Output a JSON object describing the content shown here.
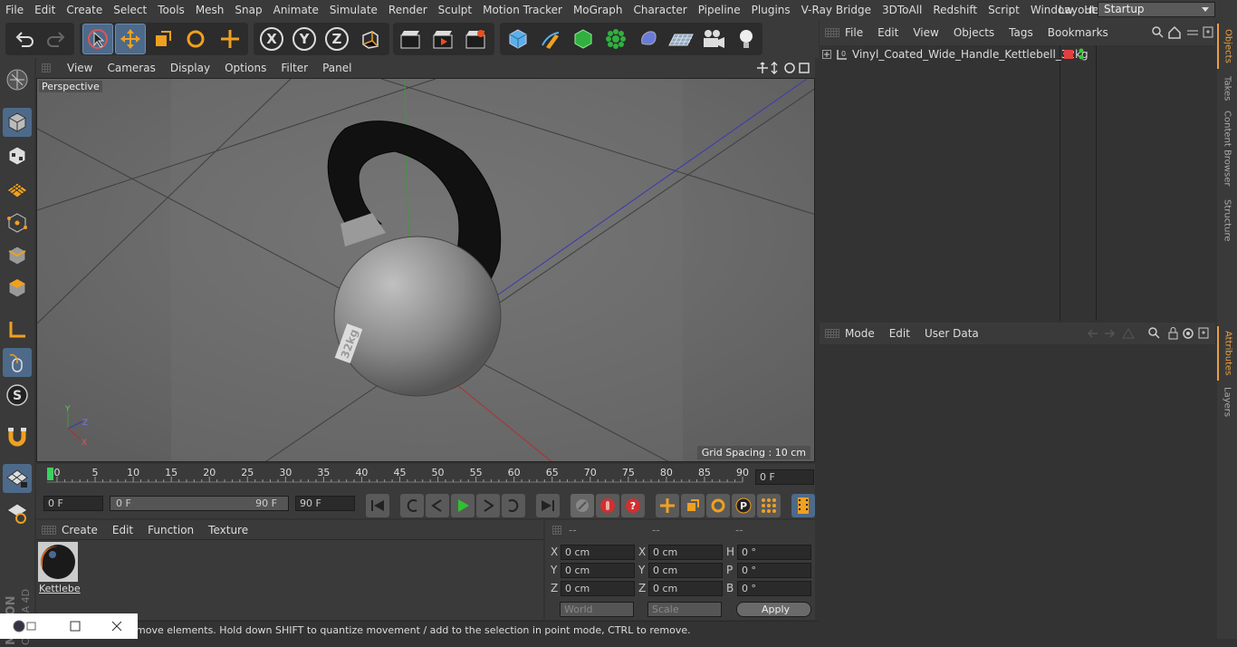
{
  "menubar": {
    "items": [
      "File",
      "Edit",
      "Create",
      "Select",
      "Tools",
      "Mesh",
      "Snap",
      "Animate",
      "Simulate",
      "Render",
      "Sculpt",
      "Motion Tracker",
      "MoGraph",
      "Character",
      "Pipeline",
      "Plugins",
      "V-Ray Bridge",
      "3DToAll",
      "Redshift",
      "Script",
      "Window",
      "Help"
    ],
    "layout_label": "Layout:",
    "layout_value": "Startup"
  },
  "viewport": {
    "menu": [
      "View",
      "Cameras",
      "Display",
      "Options",
      "Filter",
      "Panel"
    ],
    "label": "Perspective",
    "grid_spacing": "Grid Spacing : 10 cm",
    "kettlebell_text": "32kg"
  },
  "timeline": {
    "ticks": [
      "0",
      "5",
      "10",
      "15",
      "20",
      "25",
      "30",
      "35",
      "40",
      "45",
      "50",
      "55",
      "60",
      "65",
      "70",
      "75",
      "80",
      "85",
      "90"
    ],
    "current_frame": "0 F"
  },
  "transport": {
    "start_field": "0 F",
    "range_start": "0 F",
    "range_end": "90 F",
    "end_field": "90 F"
  },
  "material_manager": {
    "menu": [
      "Create",
      "Edit",
      "Function",
      "Texture"
    ],
    "material_name": "Kettlebe"
  },
  "coordinates": {
    "headers": [
      "--",
      "--",
      "--"
    ],
    "rows": [
      {
        "a_label": "X",
        "a_val": "0 cm",
        "b_label": "X",
        "b_val": "0 cm",
        "c_label": "H",
        "c_val": "0 °"
      },
      {
        "a_label": "Y",
        "a_val": "0 cm",
        "b_label": "Y",
        "b_val": "0 cm",
        "c_label": "P",
        "c_val": "0 °"
      },
      {
        "a_label": "Z",
        "a_val": "0 cm",
        "b_label": "Z",
        "b_val": "0 cm",
        "c_label": "B",
        "c_val": "0 °"
      }
    ],
    "mode_world": "World",
    "mode_scale": "Scale",
    "apply": "Apply"
  },
  "object_manager": {
    "menu": [
      "File",
      "Edit",
      "View",
      "Objects",
      "Tags",
      "Bookmarks"
    ],
    "object_name": "Vinyl_Coated_Wide_Handle_Kettlebell_32kg"
  },
  "attribute_manager": {
    "menu": [
      "Mode",
      "Edit",
      "User Data"
    ]
  },
  "right_tabs": [
    "Objects",
    "Takes",
    "Content Browser",
    "Structure",
    "Attributes",
    "Layers"
  ],
  "status": {
    "text": "move elements. Hold down SHIFT to quantize movement / add to the selection in point mode, CTRL to remove."
  },
  "branding": {
    "maxon": "MAXON",
    "cinema": "CINEMA 4D"
  },
  "colors": {
    "accent_blue": "#4d6a8a",
    "active_tab": "#e8a040",
    "play_green": "#30c030"
  }
}
